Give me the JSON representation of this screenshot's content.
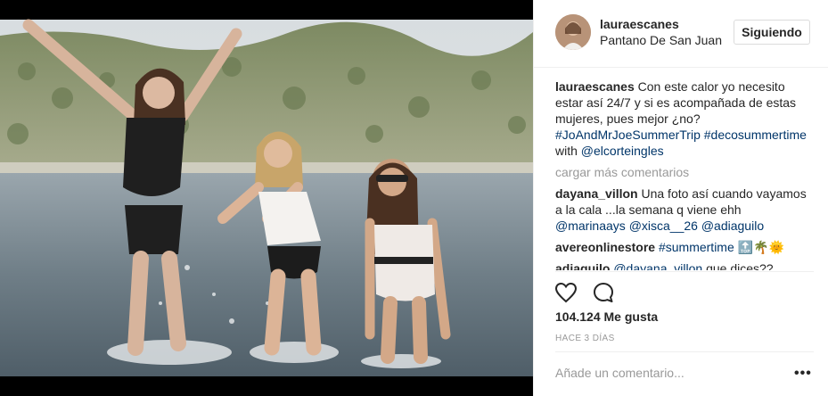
{
  "post": {
    "image_alt": "Three women splashing in a lake"
  },
  "header": {
    "username": "lauraescanes",
    "location": "Pantano De San Juan",
    "follow_label": "Siguiendo"
  },
  "caption": {
    "username": "lauraescanes",
    "text": "Con este calor yo necesito estar así 24/7 y si es acompañada de estas mujeres, pues mejor ¿no?",
    "hashtag1": "#JoAndMrJoeSummerTrip",
    "hashtag2": "#decosummertime",
    "with_word": "with",
    "mention": "@elcorteingles"
  },
  "load_more": "cargar más comentarios",
  "comments": [
    {
      "username": "dayana_villon",
      "text": "Una foto así cuando vayamos a la cala ...la semana q viene ehh",
      "m1": "@marinaays",
      "m2": "@xisca__26",
      "m3": "@adiaguilo"
    },
    {
      "username": "avereonlinestore",
      "hashtag": "#summertime",
      "emoji": "🔝🌴🌞"
    },
    {
      "username": "adiaguilo",
      "mention": "@dayana_villon",
      "text": "que dices??"
    }
  ],
  "likes": "104.124 Me gusta",
  "timestamp": "HACE 3 DÍAS",
  "comment_placeholder": "Añade un comentario...",
  "more_options": "•••",
  "colors": {
    "link": "#003569",
    "muted": "#999999",
    "border": "#efefef",
    "text": "#262626"
  }
}
